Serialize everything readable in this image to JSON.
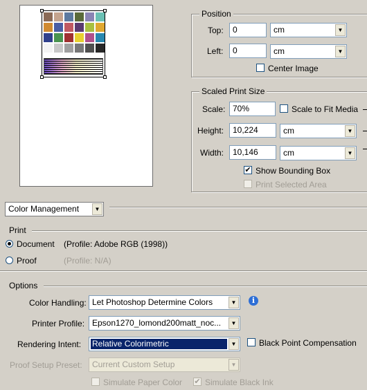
{
  "preview": {
    "swatches": [
      "#8a6a56",
      "#c4a48e",
      "#5c7aa0",
      "#5a6a3a",
      "#8a84b4",
      "#6ac0b4",
      "#d08a30",
      "#4a5ea4",
      "#c05a62",
      "#5a3a70",
      "#a8c040",
      "#e0a830",
      "#30408c",
      "#4a9450",
      "#a03030",
      "#e8d030",
      "#b0508c",
      "#2888b0",
      "#f4f4f4",
      "#c8c8c8",
      "#a0a0a0",
      "#787878",
      "#505050",
      "#282828"
    ]
  },
  "position": {
    "title": "Position",
    "top_label": "Top:",
    "top_value": "0",
    "top_unit": "cm",
    "left_label": "Left:",
    "left_value": "0",
    "left_unit": "cm",
    "center_image_label": "Center Image"
  },
  "scaled": {
    "title": "Scaled Print Size",
    "scale_label": "Scale:",
    "scale_value": "70%",
    "scale_to_fit_label": "Scale to Fit Media",
    "height_label": "Height:",
    "height_value": "10,224",
    "height_unit": "cm",
    "width_label": "Width:",
    "width_value": "10,146",
    "width_unit": "cm",
    "show_bounding_label": "Show Bounding Box",
    "print_selected_label": "Print Selected Area"
  },
  "section_select": {
    "value": "Color Management"
  },
  "print": {
    "title": "Print",
    "document_label": "Document",
    "document_profile": "(Profile: Adobe RGB (1998))",
    "proof_label": "Proof",
    "proof_profile": "(Profile: N/A)"
  },
  "options": {
    "title": "Options",
    "color_handling_label": "Color Handling:",
    "color_handling_value": "Let Photoshop Determine Colors",
    "printer_profile_label": "Printer Profile:",
    "printer_profile_value": "Epson1270_lomond200matt_noc...",
    "rendering_intent_label": "Rendering Intent:",
    "rendering_intent_value": "Relative Colorimetric",
    "black_point_label": "Black Point Compensation",
    "proof_setup_label": "Proof Setup Preset:",
    "proof_setup_value": "Current Custom Setup",
    "simulate_paper_label": "Simulate Paper Color",
    "simulate_ink_label": "Simulate Black Ink"
  },
  "checkmark": "✔",
  "arrow_glyph": "▼",
  "info_glyph": "i"
}
